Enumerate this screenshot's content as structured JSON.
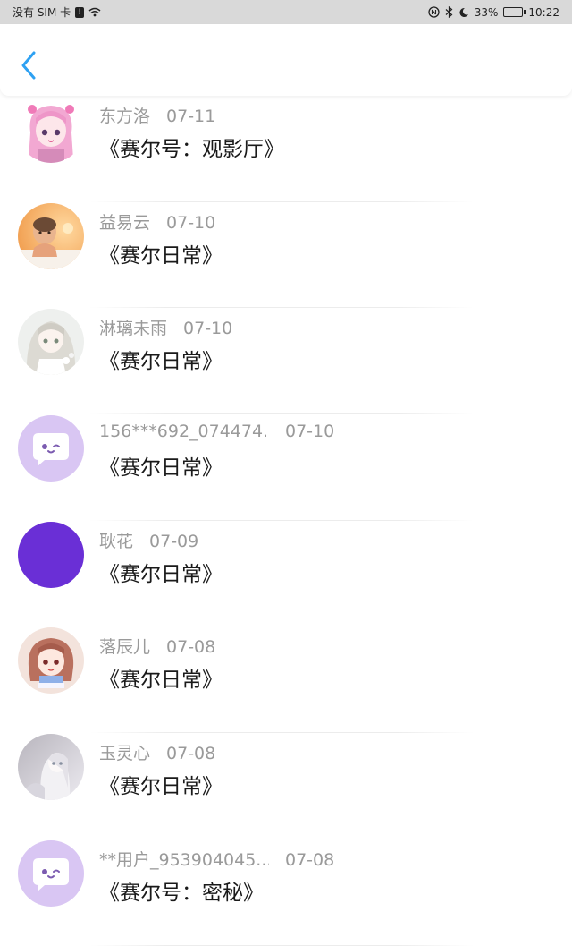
{
  "status_bar": {
    "carrier": "没有 SIM 卡",
    "sim_badge": "!",
    "battery_percent": "33%",
    "time": "10:22",
    "battery_level": 0.33
  },
  "header": {
    "back_icon": "chevron-left-icon",
    "accent": "#2ea1f2"
  },
  "items": [
    {
      "name": "东方洛",
      "date": "07-11",
      "title": "《赛尔号：观影厅》",
      "avatar": "anime-pink"
    },
    {
      "name": "益易云",
      "date": "07-10",
      "title": "《赛尔日常》",
      "avatar": "baby-photo"
    },
    {
      "name": "淋璃未雨",
      "date": "07-10",
      "title": "《赛尔日常》",
      "avatar": "anime-white"
    },
    {
      "name": "156***692_074474..",
      "date": "07-10",
      "title": "《赛尔日常》",
      "avatar": "default-chat"
    },
    {
      "name": "耿花",
      "date": "07-09",
      "title": "《赛尔日常》",
      "avatar": "purple-solid"
    },
    {
      "name": "落辰儿",
      "date": "07-08",
      "title": "《赛尔日常》",
      "avatar": "anime-brown"
    },
    {
      "name": "玉灵心",
      "date": "07-08",
      "title": "《赛尔日常》",
      "avatar": "anime-grey"
    },
    {
      "name": "**用户_953904045...",
      "date": "07-08",
      "title": "《赛尔号：密秘》",
      "avatar": "default-chat"
    }
  ]
}
